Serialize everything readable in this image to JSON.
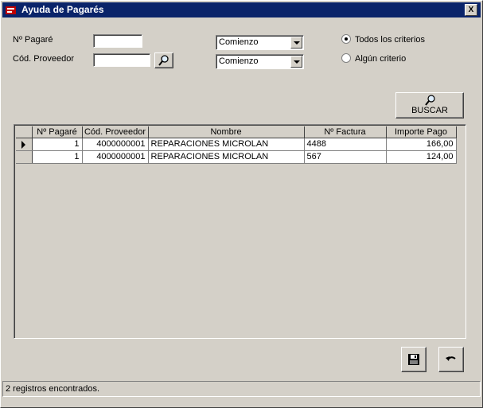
{
  "window": {
    "title": "Ayuda de Pagarés",
    "close_label": "X"
  },
  "filters": {
    "pagare_label": "Nº Pagaré",
    "pagare_value": "",
    "proveedor_label": "Cód. Proveedor",
    "proveedor_value": "",
    "pagare_match": "Comienzo",
    "proveedor_match": "Comienzo"
  },
  "criteria": {
    "all_label": "Todos los criterios",
    "any_label": "Algún criterio",
    "selected": "all"
  },
  "buscar_label": "BUSCAR",
  "grid": {
    "columns": [
      "Nº Pagaré",
      "Cód. Proveedor",
      "Nombre",
      "Nº Factura",
      "Importe Pago"
    ],
    "rows": [
      [
        "1",
        "4000000001",
        "REPARACIONES MICROLAN",
        "4488",
        "166,00"
      ],
      [
        "1",
        "4000000001",
        "REPARACIONES MICROLAN",
        "567",
        "124,00"
      ]
    ]
  },
  "status": "2 registros encontrados.",
  "icons": {
    "app": "app-icon",
    "search": "magnifier-icon",
    "save": "floppy-disk-icon",
    "undo": "undo-arrow-icon"
  }
}
